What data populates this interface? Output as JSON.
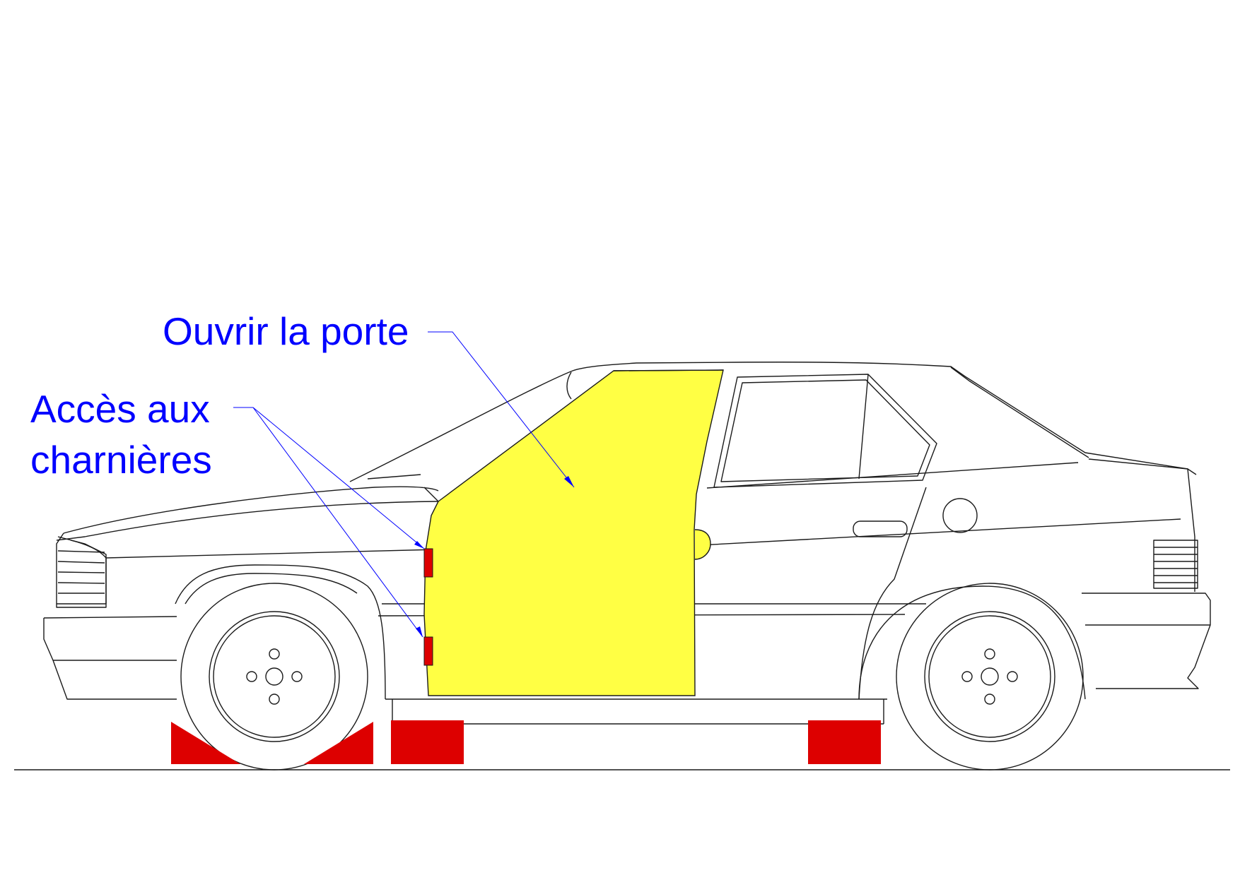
{
  "labels": {
    "open_door": "Ouvrir la porte",
    "hinge_access_line1": "Accès aux",
    "hinge_access_line2": "charnières"
  },
  "colors": {
    "annotation": "#0000ff",
    "door_highlight": "#ffff44",
    "hinge": "#dd0000",
    "support_blocks": "#dd0000",
    "outline": "#1a1a1a"
  }
}
